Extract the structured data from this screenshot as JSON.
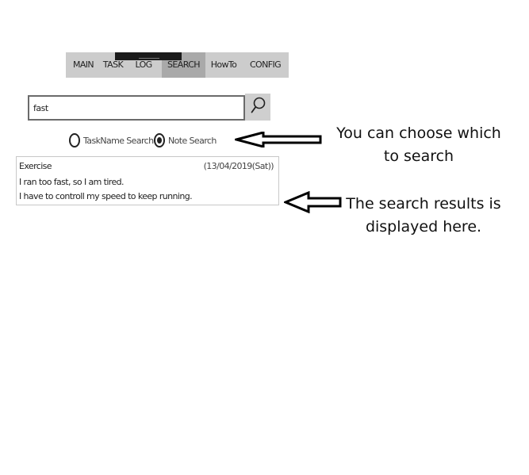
{
  "tabs": [
    {
      "label": "MAIN"
    },
    {
      "label": "TASK"
    },
    {
      "label": "LOG"
    },
    {
      "label": "SEARCH",
      "active": true
    },
    {
      "label": "HowTo"
    },
    {
      "label": "CONFIG"
    }
  ],
  "search": {
    "value": "fast",
    "button_icon": "search-icon"
  },
  "search_mode": {
    "options": [
      {
        "label": "TaskName Search",
        "selected": false
      },
      {
        "label": "Note Search",
        "selected": true
      }
    ]
  },
  "results": [
    {
      "title": "Exercise",
      "date": "(13/04/2019(Sat))",
      "lines": [
        "I ran too fast, so I am tired.",
        "I have to controll my speed to keep running."
      ]
    }
  ],
  "annotations": {
    "choose": "You can choose which to search",
    "results": "The search results is displayed here."
  },
  "colors": {
    "tabbar_bg": "#cccccc",
    "active_tab_bg": "#a9a9a9",
    "active_indicator": "#1b1b1b",
    "search_button_bg": "#cfcfcf"
  }
}
